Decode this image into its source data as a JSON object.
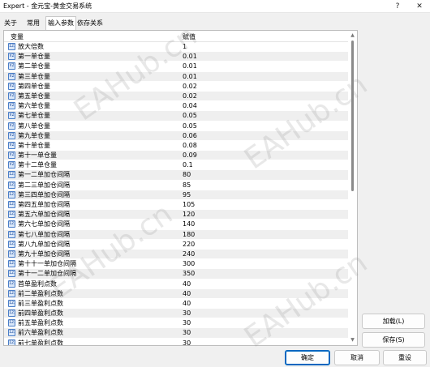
{
  "window": {
    "title": "Expert - 金元宝-黄金交易系统",
    "help_glyph": "?",
    "close_glyph": "✕"
  },
  "tabs": [
    {
      "label": "关于"
    },
    {
      "label": "常用"
    },
    {
      "label": "输入参数",
      "active": true
    },
    {
      "label": "依存关系"
    }
  ],
  "table": {
    "col_variable": "变量",
    "col_value": "赋值",
    "rows": [
      {
        "name": "放大倍数",
        "value": "1",
        "type": "int"
      },
      {
        "name": "第一单仓量",
        "value": "0.01",
        "type": "double"
      },
      {
        "name": "第二单仓量",
        "value": "0.01",
        "type": "double"
      },
      {
        "name": "第三单仓量",
        "value": "0.01",
        "type": "double"
      },
      {
        "name": "第四单仓量",
        "value": "0.02",
        "type": "double"
      },
      {
        "name": "第五单仓量",
        "value": "0.02",
        "type": "double"
      },
      {
        "name": "第六单仓量",
        "value": "0.04",
        "type": "double"
      },
      {
        "name": "第七单仓量",
        "value": "0.05",
        "type": "double"
      },
      {
        "name": "第八单仓量",
        "value": "0.05",
        "type": "double"
      },
      {
        "name": "第九单仓量",
        "value": "0.06",
        "type": "double"
      },
      {
        "name": "第十单仓量",
        "value": "0.08",
        "type": "double"
      },
      {
        "name": "第十一单仓量",
        "value": "0.09",
        "type": "double"
      },
      {
        "name": "第十二单仓量",
        "value": "0.1",
        "type": "double"
      },
      {
        "name": "第一二单加仓间隔",
        "value": "80",
        "type": "int"
      },
      {
        "name": "第二三单加仓间隔",
        "value": "85",
        "type": "int"
      },
      {
        "name": "第三四单加仓间隔",
        "value": "95",
        "type": "int"
      },
      {
        "name": "第四五单加仓间隔",
        "value": "105",
        "type": "int"
      },
      {
        "name": "第五六单加仓间隔",
        "value": "120",
        "type": "int"
      },
      {
        "name": "第六七单加仓间隔",
        "value": "140",
        "type": "int"
      },
      {
        "name": "第七八单加仓间隔",
        "value": "180",
        "type": "int"
      },
      {
        "name": "第八九单加仓间隔",
        "value": "220",
        "type": "int"
      },
      {
        "name": "第九十单加仓间隔",
        "value": "240",
        "type": "int"
      },
      {
        "name": "第十十一单加仓间隔",
        "value": "300",
        "type": "int"
      },
      {
        "name": "第十一二单加仓间隔",
        "value": "350",
        "type": "int"
      },
      {
        "name": "首单盈利点数",
        "value": "40",
        "type": "int"
      },
      {
        "name": "前二单盈利点数",
        "value": "40",
        "type": "int"
      },
      {
        "name": "前三单盈利点数",
        "value": "40",
        "type": "int"
      },
      {
        "name": "前四单盈利点数",
        "value": "30",
        "type": "int"
      },
      {
        "name": "前五单盈利点数",
        "value": "30",
        "type": "int"
      },
      {
        "name": "前六单盈利点数",
        "value": "30",
        "type": "int"
      },
      {
        "name": "前七单盈利点数",
        "value": "30",
        "type": "int"
      }
    ]
  },
  "side_buttons": {
    "load": "加载(L)",
    "save": "保存(S)"
  },
  "footer": {
    "ok": "确定",
    "cancel": "取消",
    "reset": "重设"
  },
  "watermark_text": "EAHub.cn"
}
